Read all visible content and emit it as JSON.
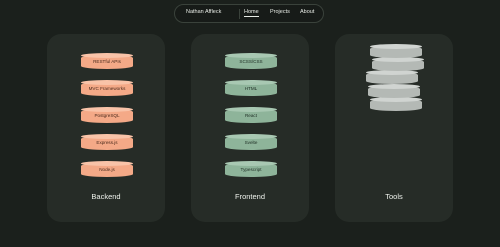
{
  "nav": {
    "brand": "Nathan Affleck",
    "links": [
      "Home",
      "Projects",
      "About"
    ]
  },
  "cards": [
    {
      "title": "Backend",
      "items": [
        "RESTful APIs",
        "MVC Frameworks",
        "PostgreSQL",
        "Express.js",
        "Node.js"
      ]
    },
    {
      "title": "Frontend",
      "items": [
        "SCSS/CSS",
        "HTML",
        "React",
        "Svelte",
        "Typescript"
      ]
    },
    {
      "title": "Tools",
      "items": []
    }
  ],
  "colors": {
    "background": "#1b201c",
    "card": "#262c27",
    "backend_accent": "#f4a987",
    "frontend_accent": "#8eb49a",
    "tools_accent": "#b4b9b5"
  }
}
